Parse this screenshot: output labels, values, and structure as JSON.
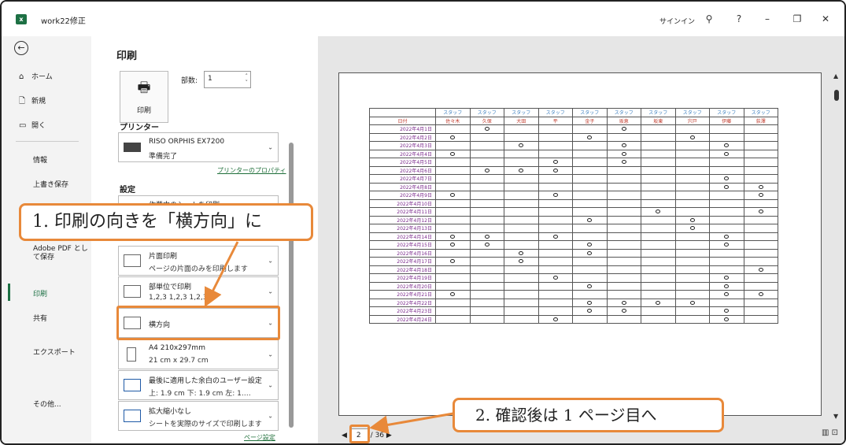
{
  "app": {
    "file_title": "work22修正",
    "signin": "サインイン",
    "help": "?"
  },
  "nav": {
    "home": "ホーム",
    "new": "新規",
    "open": "開く",
    "info": "情報",
    "save_as_over": "上書き保存",
    "adobe_pdf": "Adobe PDF として保存",
    "print": "印刷",
    "share": "共有",
    "export": "エクスポート",
    "more": "その他..."
  },
  "print_panel": {
    "title": "印刷",
    "print_button": "印刷",
    "copies_label": "部数:",
    "copies_value": "1",
    "printer_heading": "プリンター",
    "printer_name": "RISO ORPHIS EX7200",
    "printer_status": "準備完了",
    "printer_props_link": "プリンターのプロパティ",
    "settings_heading": "設定",
    "active_sheets": "作業中のシートを印刷",
    "sides_main": "片面印刷",
    "sides_sub": "ページの片面のみを印刷します",
    "collate_main": "部単位で印刷",
    "collate_sub": "1,2,3    1,2,3    1,2,3",
    "orientation": "横方向",
    "paper_main": "A4 210x297mm",
    "paper_sub": "21 cm x 29.7 cm",
    "margins_main": "最後に適用した余白のユーザー設定",
    "margins_sub": "上: 1.9 cm 下: 1.9 cm 左: 1.…",
    "scaling_main": "拡大縮小なし",
    "scaling_sub": "シートを実際のサイズで印刷します",
    "page_setup_link": "ページ設定"
  },
  "preview": {
    "current_page": "2",
    "total_pages": "/ 36"
  },
  "sheet": {
    "header_row1": [
      "",
      "スタッフ",
      "スタッフ",
      "スタッフ",
      "スタッフ",
      "スタッフ",
      "スタッフ",
      "スタッフ",
      "スタッフ",
      "スタッフ",
      "スタッフ"
    ],
    "header_row2": [
      "日付",
      "佐々木",
      "久保",
      "大田",
      "平",
      "金子",
      "坂恵",
      "坂東",
      "宍戸",
      "伊藤",
      "荻澤"
    ],
    "rows": [
      {
        "date": "2022年4月1日",
        "marks": [
          0,
          1,
          0,
          0,
          0,
          1,
          0,
          0,
          0,
          0
        ]
      },
      {
        "date": "2022年4月2日",
        "marks": [
          1,
          0,
          0,
          0,
          1,
          0,
          0,
          1,
          0,
          0
        ]
      },
      {
        "date": "2022年4月3日",
        "marks": [
          0,
          0,
          1,
          0,
          0,
          1,
          0,
          0,
          1,
          0
        ]
      },
      {
        "date": "2022年4月4日",
        "marks": [
          1,
          0,
          0,
          0,
          0,
          1,
          0,
          0,
          1,
          0
        ]
      },
      {
        "date": "2022年4月5日",
        "marks": [
          0,
          0,
          0,
          1,
          0,
          1,
          0,
          0,
          0,
          0
        ]
      },
      {
        "date": "2022年4月6日",
        "marks": [
          0,
          1,
          1,
          1,
          0,
          0,
          0,
          0,
          0,
          0
        ]
      },
      {
        "date": "2022年4月7日",
        "marks": [
          0,
          0,
          0,
          0,
          0,
          0,
          0,
          0,
          1,
          0
        ]
      },
      {
        "date": "2022年4月8日",
        "marks": [
          0,
          0,
          0,
          0,
          0,
          0,
          0,
          0,
          1,
          1
        ]
      },
      {
        "date": "2022年4月9日",
        "marks": [
          1,
          0,
          0,
          1,
          0,
          0,
          0,
          0,
          0,
          1
        ]
      },
      {
        "date": "2022年4月10日",
        "marks": [
          0,
          0,
          0,
          0,
          0,
          0,
          0,
          0,
          0,
          0
        ]
      },
      {
        "date": "2022年4月11日",
        "marks": [
          0,
          0,
          0,
          0,
          0,
          0,
          1,
          0,
          0,
          1
        ]
      },
      {
        "date": "2022年4月12日",
        "marks": [
          0,
          0,
          0,
          0,
          1,
          0,
          0,
          1,
          0,
          0
        ]
      },
      {
        "date": "2022年4月13日",
        "marks": [
          0,
          0,
          0,
          0,
          0,
          0,
          0,
          1,
          0,
          0
        ]
      },
      {
        "date": "2022年4月14日",
        "marks": [
          1,
          1,
          0,
          1,
          0,
          0,
          0,
          0,
          1,
          0
        ]
      },
      {
        "date": "2022年4月15日",
        "marks": [
          1,
          1,
          0,
          0,
          1,
          0,
          0,
          0,
          1,
          0
        ]
      },
      {
        "date": "2022年4月16日",
        "marks": [
          0,
          0,
          1,
          0,
          1,
          0,
          0,
          0,
          0,
          0
        ]
      },
      {
        "date": "2022年4月17日",
        "marks": [
          1,
          0,
          1,
          0,
          0,
          0,
          0,
          0,
          0,
          0
        ]
      },
      {
        "date": "2022年4月18日",
        "marks": [
          0,
          0,
          0,
          0,
          0,
          0,
          0,
          0,
          0,
          1
        ]
      },
      {
        "date": "2022年4月19日",
        "marks": [
          0,
          0,
          0,
          1,
          0,
          0,
          0,
          0,
          1,
          0
        ]
      },
      {
        "date": "2022年4月20日",
        "marks": [
          0,
          0,
          0,
          0,
          1,
          0,
          0,
          0,
          1,
          0
        ]
      },
      {
        "date": "2022年4月21日",
        "marks": [
          1,
          0,
          0,
          0,
          0,
          0,
          0,
          0,
          1,
          1
        ]
      },
      {
        "date": "2022年4月22日",
        "marks": [
          0,
          0,
          0,
          0,
          1,
          1,
          1,
          1,
          0,
          0
        ]
      },
      {
        "date": "2022年4月23日",
        "marks": [
          0,
          0,
          0,
          0,
          1,
          1,
          0,
          0,
          1,
          0
        ]
      },
      {
        "date": "2022年4月24日",
        "marks": [
          0,
          0,
          0,
          1,
          0,
          0,
          0,
          0,
          1,
          0
        ]
      }
    ]
  },
  "callouts": {
    "step1": "1. 印刷の向きを「横方向」に",
    "step2": "2. 確認後は 1 ページ目へ"
  },
  "colors": {
    "accent": "#e8893a",
    "excel_green": "#1d7044"
  }
}
